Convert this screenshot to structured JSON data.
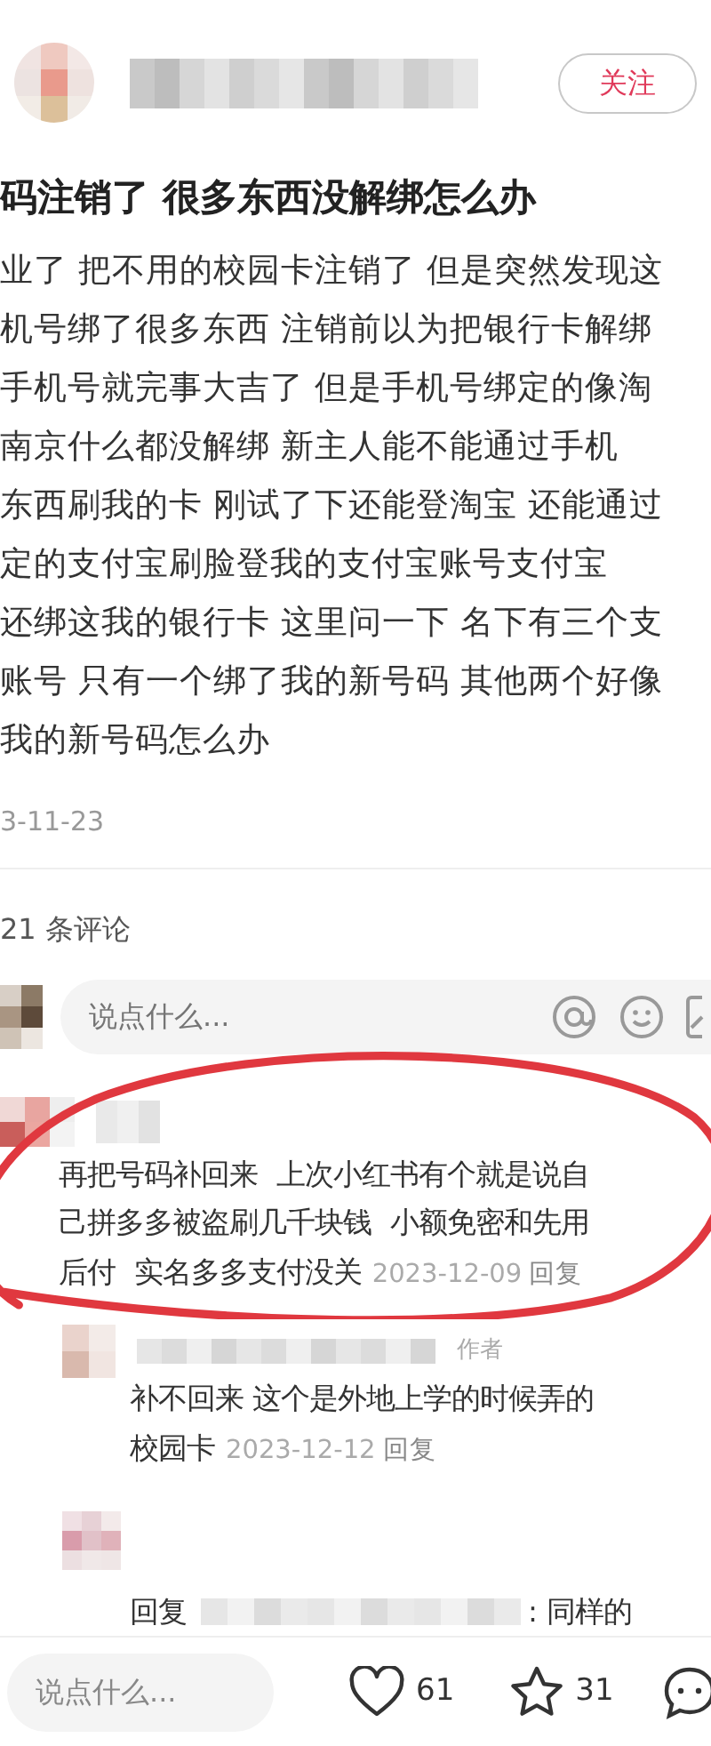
{
  "header": {
    "follow_button": "关注"
  },
  "post": {
    "title": "码注销了 很多东西没解绑怎么办",
    "body_lines": [
      "业了 把不用的校园卡注销了 但是突然发现这",
      "机号绑了很多东西 注销前以为把银行卡解绑",
      "手机号就完事大吉了 但是手机号绑定的像淘",
      "南京什么都没解绑 新主人能不能通过手机",
      "东西刷我的卡 刚试了下还能登淘宝 还能通过",
      "定的支付宝刷脸登我的支付宝账号支付宝",
      "还绑这我的银行卡 这里问一下 名下有三个支",
      "账号 只有一个绑了我的新号码 其他两个好像",
      "我的新号码怎么办"
    ],
    "date": "3-11-23"
  },
  "comments_count": "21 条评论",
  "comment_input": {
    "placeholder": "说点什么..."
  },
  "comments": [
    {
      "kind": "comment",
      "lines": [
        "再把号码补回来  上次小红书有个就是说自",
        "己拼多多被盗刷几千块钱  小额免密和先用",
        "后付  实名多多支付没关"
      ],
      "date": "2023-12-09",
      "reply": "回复",
      "highlighted": true
    },
    {
      "kind": "reply",
      "author_tag": "作者",
      "lines": [
        "补不回来 这个是外地上学的时候弄的",
        "校园卡"
      ],
      "date": "2023-12-12",
      "reply": "回复",
      "highlighted": false
    },
    {
      "kind": "reply_to",
      "prefix": "回复",
      "suffix": ": 同样的",
      "highlighted": false
    }
  ],
  "bottom_bar": {
    "placeholder": "说点什么...",
    "likes": "61",
    "favorites": "31"
  }
}
